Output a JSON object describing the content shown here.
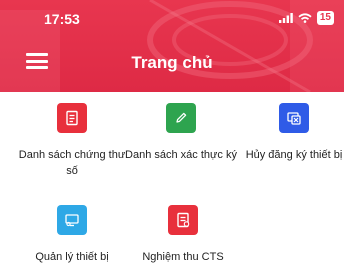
{
  "status": {
    "time": "17:53",
    "battery": "15"
  },
  "header": {
    "title": "Trang chủ"
  },
  "colors": {
    "header": "#e8364f",
    "red": "#e8303c",
    "green": "#2ea44f",
    "blue": "#2f5be7",
    "cyan": "#2ea8e6"
  },
  "menu": [
    {
      "label": "Danh sách chứng thư số",
      "icon": "document-list-icon"
    },
    {
      "label": "Danh sách xác thực ký",
      "icon": "pencil-icon"
    },
    {
      "label": "Hủy đăng ký thiết bị",
      "icon": "device-cancel-icon"
    },
    {
      "label": "Quản lý thiết bị",
      "icon": "device-manage-icon"
    },
    {
      "label": "Nghiệm thu CTS",
      "icon": "document-check-icon"
    }
  ]
}
